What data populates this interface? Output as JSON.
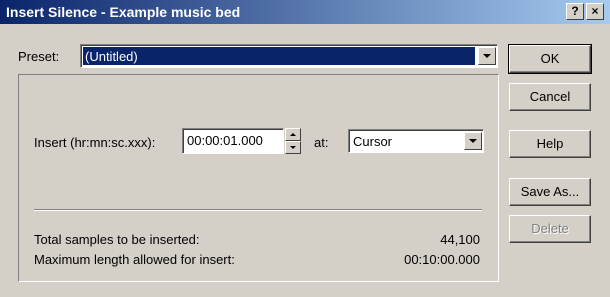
{
  "window": {
    "title": "Insert Silence - Example music bed",
    "help_button": "?",
    "close_button": "×"
  },
  "preset": {
    "label": "Preset:",
    "value": "(Untitled)"
  },
  "buttons": {
    "ok": "OK",
    "cancel": "Cancel",
    "help": "Help",
    "save_as": "Save As...",
    "delete": "Delete"
  },
  "insert": {
    "label": "Insert (hr:mn:sc.xxx):",
    "value": "00:00:01.000",
    "at_label": "at:",
    "at_value": "Cursor"
  },
  "info": {
    "total_samples_label": "Total samples to be inserted:",
    "total_samples_value": "44,100",
    "max_length_label": "Maximum length allowed for insert:",
    "max_length_value": "00:10:00.000"
  },
  "colors": {
    "title_gradient_start": "#0a246a",
    "title_gradient_end": "#a6caf0",
    "selection": "#0a246a",
    "face": "#d4d0c8"
  }
}
